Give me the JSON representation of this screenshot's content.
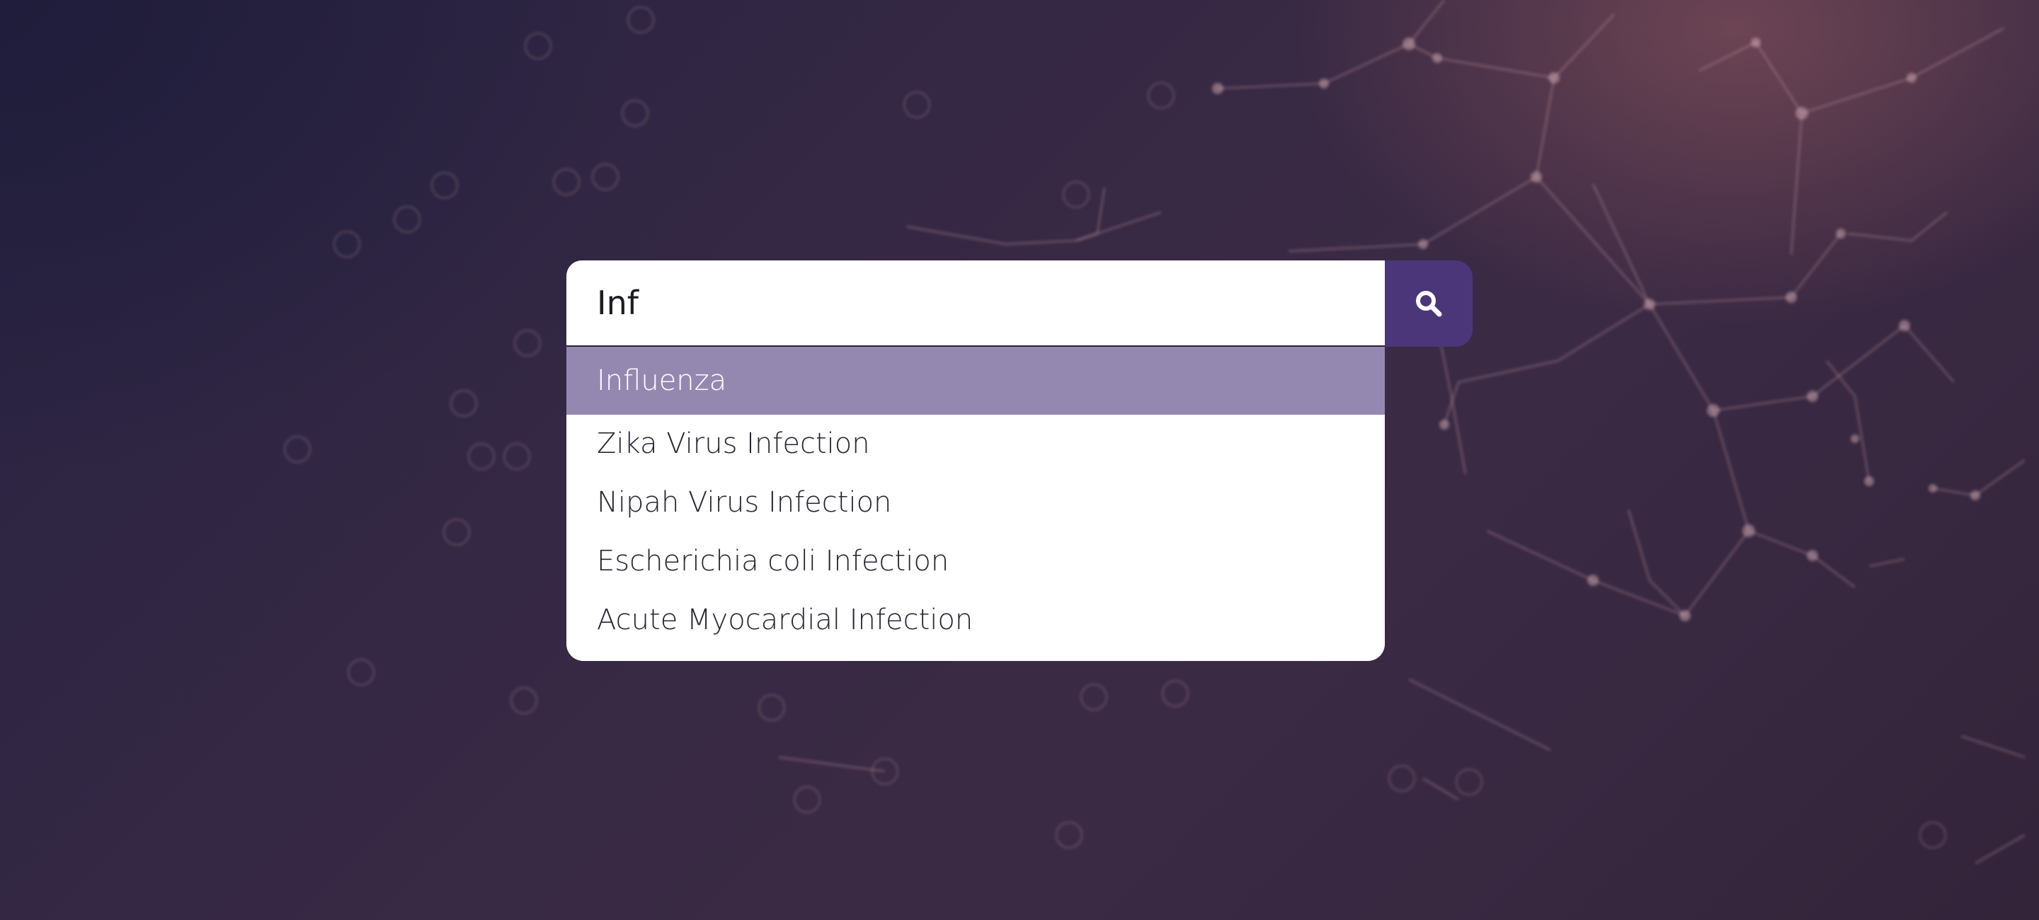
{
  "search": {
    "query": "Inf",
    "button_icon": "search-icon"
  },
  "suggestions": [
    {
      "label": "Influenza",
      "highlighted": true
    },
    {
      "label": "Zika Virus Infection",
      "highlighted": false
    },
    {
      "label": "Nipah Virus Infection",
      "highlighted": false
    },
    {
      "label": "Escherichia coli Infection",
      "highlighted": false
    },
    {
      "label": "Acute Myocardial Infection",
      "highlighted": false
    }
  ],
  "colors": {
    "accent": "#4a3678",
    "highlight": "#9588b0",
    "background": "#352842"
  }
}
